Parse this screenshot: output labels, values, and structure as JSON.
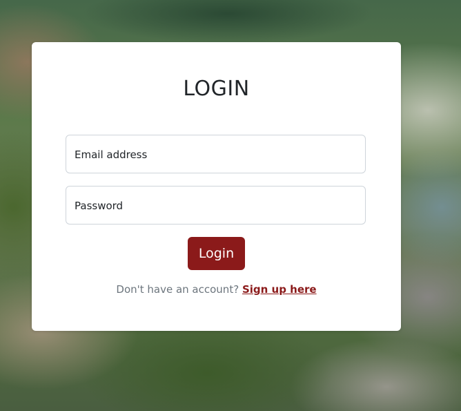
{
  "login": {
    "title": "LOGIN",
    "email_placeholder": "Email address",
    "password_placeholder": "Password",
    "button_label": "Login",
    "signup_prompt": "Don't have an account?",
    "signup_link": "Sign up here"
  },
  "colors": {
    "accent": "#8b1a1a",
    "text": "#212529",
    "muted": "#6c757d",
    "border": "#ced4da"
  }
}
